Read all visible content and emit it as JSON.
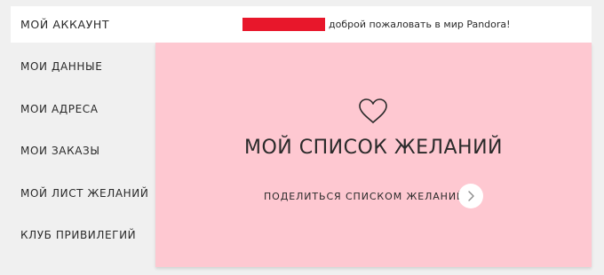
{
  "header": {
    "account_label": "МОЙ АККАУНТ",
    "welcome_text": "доброй пожаловать в мир Pandora!",
    "redaction_color": "#e8172b"
  },
  "sidebar": {
    "items": [
      {
        "label": "МОИ ДАННЫЕ"
      },
      {
        "label": "МОИ АДРЕСА"
      },
      {
        "label": "МОИ ЗАКАЗЫ"
      },
      {
        "label": "МОЙ ЛИСТ ЖЕЛАНИЙ"
      },
      {
        "label": "КЛУБ ПРИВИЛЕГИЙ"
      }
    ]
  },
  "wishlist": {
    "icon": "heart-icon",
    "title": "МОЙ СПИСОК ЖЕЛАНИЙ",
    "share_label": "ПОДЕЛИТЬСЯ СПИСКОМ ЖЕЛАНИЙ",
    "share_icon": "chevron-right-icon",
    "background_color": "#fec8d1"
  }
}
